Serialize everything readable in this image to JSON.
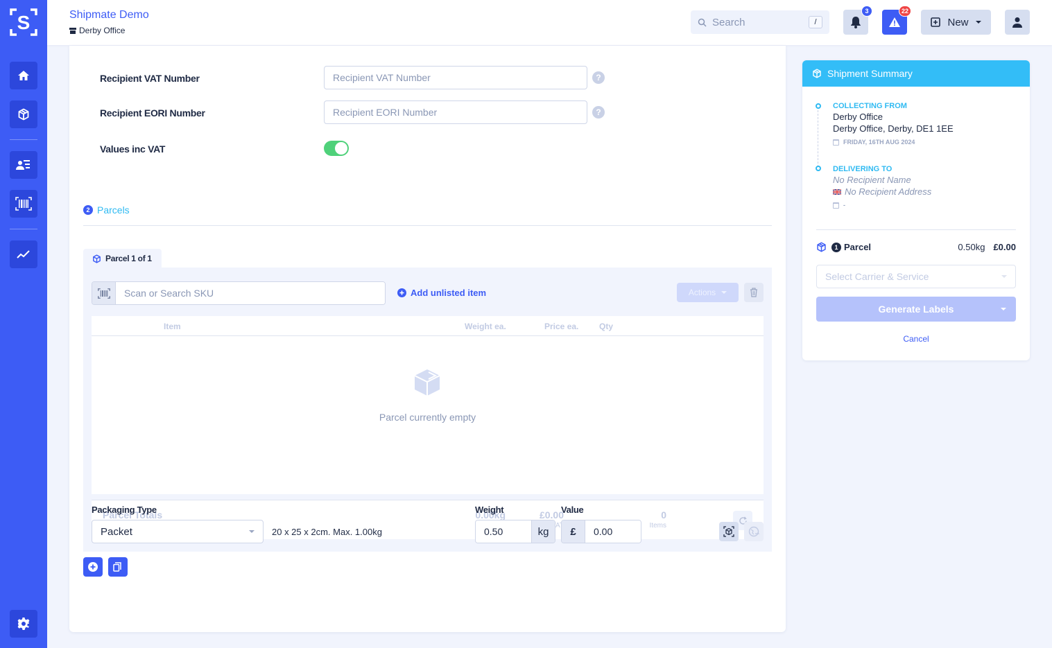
{
  "app": {
    "title": "Shipmate Demo",
    "location": "Derby Office",
    "colors": {
      "brand": "#3d5cf5",
      "accent": "#33bdf7",
      "success": "#4fd17a",
      "danger": "#ef4444"
    }
  },
  "sidebar": {
    "items": [
      {
        "name": "home",
        "icon": "home-icon"
      },
      {
        "name": "shipments",
        "icon": "box-icon",
        "active": true
      },
      {
        "name": "contacts",
        "icon": "contact-list-icon"
      },
      {
        "name": "scan",
        "icon": "barcode-icon"
      },
      {
        "name": "reports",
        "icon": "trend-chart-icon"
      }
    ],
    "settings_icon": "gear-icon"
  },
  "header": {
    "search_placeholder": "Search",
    "search_shortcut": "/",
    "notifications_count": "3",
    "alerts_count": "22",
    "new_label": "New"
  },
  "form": {
    "vat_label": "Recipient VAT Number",
    "vat_placeholder": "Recipient VAT Number",
    "vat_value": "",
    "eori_label": "Recipient EORI Number",
    "eori_placeholder": "Recipient EORI Number",
    "eori_value": "",
    "values_inc_vat_label": "Values inc VAT",
    "values_inc_vat": true,
    "help_glyph": "?"
  },
  "parcels_section": {
    "step": "2",
    "title": "Parcels",
    "tab_label": "Parcel 1 of 1",
    "sku_placeholder": "Scan or Search SKU",
    "add_unlisted_label": "Add unlisted item",
    "actions_label": "Actions",
    "table_headers": [
      "Item",
      "Weight ea.",
      "Price ea.",
      "Qty"
    ],
    "rows": [],
    "empty_text": "Parcel currently empty",
    "totals": {
      "label": "Parcel Totals",
      "weight": "0.00kg",
      "price": "£0.00",
      "price_sub": "inc. VAT",
      "qty": "0",
      "qty_sub": "Items"
    },
    "packaging_label": "Packaging Type",
    "packaging_value": "Packet",
    "packaging_dims": "20 x 25 x 2cm. Max. 1.00kg",
    "weight_label": "Weight",
    "weight_value": "0.50",
    "weight_unit": "kg",
    "value_label": "Value",
    "value_currency": "£",
    "value_value": "0.00"
  },
  "summary": {
    "title": "Shipment Summary",
    "collecting_label": "COLLECTING FROM",
    "collecting_name": "Derby Office",
    "collecting_address": "Derby Office, Derby, DE1 1EE",
    "collecting_date": "FRIDAY, 16TH AUG 2024",
    "delivering_label": "DELIVERING TO",
    "delivering_name": "No Recipient Name",
    "delivering_address": "No Recipient Address",
    "delivering_date": "-",
    "parcel_count": "1",
    "parcel_label": "Parcel",
    "parcel_weight": "0.50kg",
    "parcel_value": "£0.00",
    "carrier_placeholder": "Select Carrier & Service",
    "generate_label": "Generate Labels",
    "cancel_label": "Cancel"
  }
}
